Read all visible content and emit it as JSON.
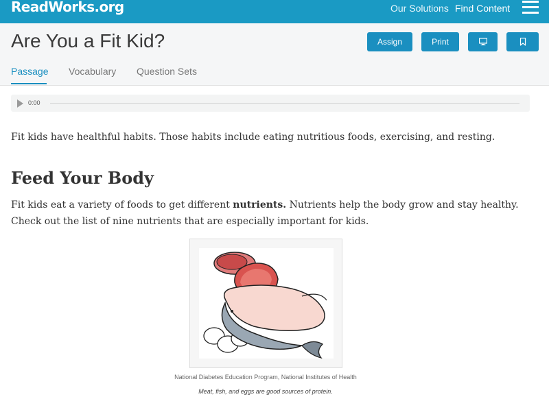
{
  "nav": {
    "logo": "ReadWorks.org",
    "links": [
      "Our Solutions",
      "Find Content"
    ],
    "menu_icon": "hamburger-icon",
    "bar_color": "#1a9ac4"
  },
  "header": {
    "title": "Are You a Fit Kid?",
    "buttons": {
      "assign": "Assign",
      "print": "Print",
      "present_icon": "monitor-icon",
      "bookmark_icon": "bookmark-icon"
    },
    "tabs": [
      {
        "label": "Passage",
        "active": true
      },
      {
        "label": "Vocabulary",
        "active": false
      },
      {
        "label": "Question Sets",
        "active": false
      }
    ],
    "accent": "#1a8fc0"
  },
  "audio": {
    "time": "0:00",
    "progress": 0
  },
  "passage": {
    "intro": "Fit kids have healthful habits. Those habits include eating nutritious foods, exercising, and resting.",
    "heading": "Feed Your Body",
    "para_before_bold": "Fit kids eat a variety of foods to get different ",
    "para_bold": "nutrients.",
    "para_after_bold": " Nutrients help the body grow and stay healthy. Check out the list of nine nutrients that are especially important for kids."
  },
  "figure": {
    "credit": "National Diabetes Education Program, National Institutes of Health",
    "caption": "Meat, fish, and eggs are good sources of protein."
  }
}
